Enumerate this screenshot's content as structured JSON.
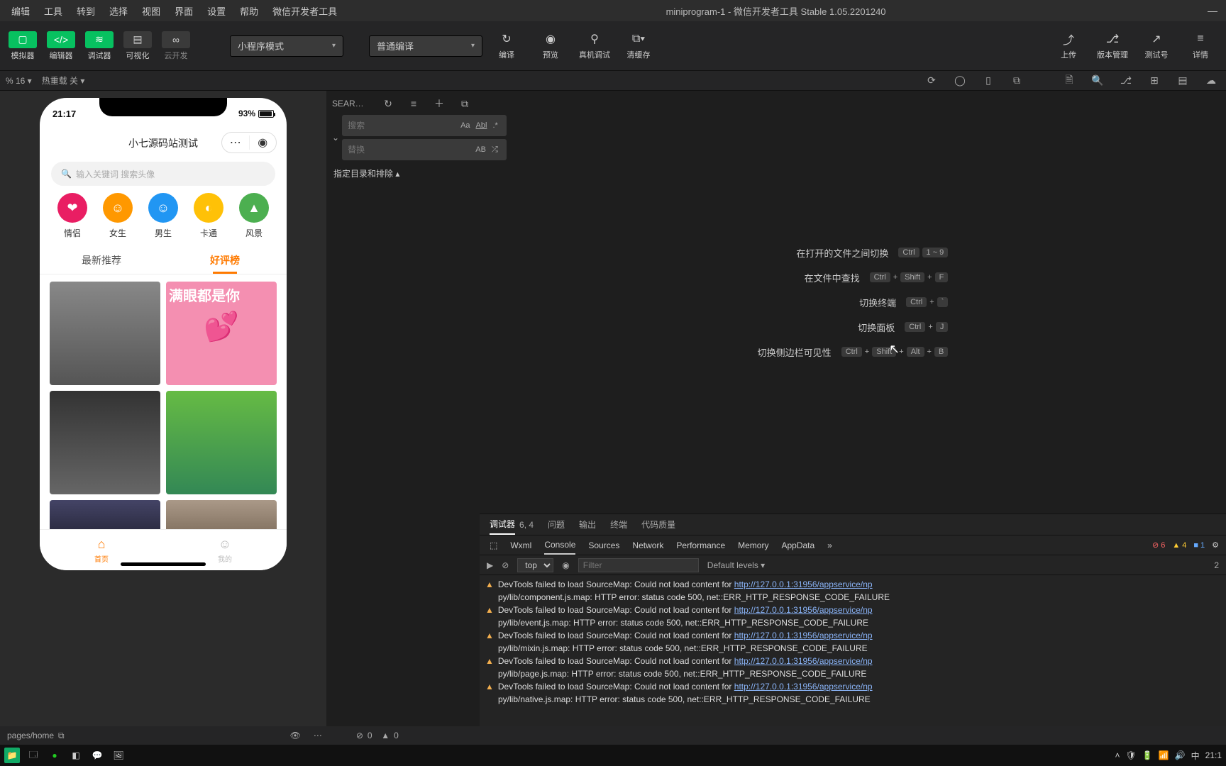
{
  "menu": [
    "编辑",
    "工具",
    "转到",
    "选择",
    "视图",
    "界面",
    "设置",
    "帮助",
    "微信开发者工具"
  ],
  "title": "miniprogram-1 - 微信开发者工具 Stable 1.05.2201240",
  "toolbar": {
    "views": [
      {
        "label": "模拟器"
      },
      {
        "label": "编辑器"
      },
      {
        "label": "调试器"
      },
      {
        "label": "可视化"
      },
      {
        "label": "云开发"
      }
    ],
    "mode": "小程序模式",
    "compile": "普通编译",
    "actions": [
      "编译",
      "预览",
      "真机调试",
      "清缓存"
    ],
    "right": [
      "上传",
      "版本管理",
      "测试号",
      "详情"
    ]
  },
  "status": {
    "zoom": "% 16 ▾",
    "hot": "热重载 关 ▾"
  },
  "phone": {
    "time": "21:17",
    "battery": "93%",
    "title": "小七源码站测试",
    "search": "输入关键词 搜索头像",
    "cats": [
      {
        "l": "情侣",
        "c": "#e91e63"
      },
      {
        "l": "女生",
        "c": "#ff9800"
      },
      {
        "l": "男生",
        "c": "#2196f3"
      },
      {
        "l": "卡通",
        "c": "#ffc107"
      },
      {
        "l": "风景",
        "c": "#4caf50"
      }
    ],
    "tabs": [
      "最新推荐",
      "好评榜"
    ],
    "tabActive": 1,
    "tiles": [
      "",
      "满眼都是你",
      "",
      "",
      "",
      ""
    ],
    "nav": [
      {
        "l": "首页",
        "a": true
      },
      {
        "l": "我的",
        "a": false
      }
    ]
  },
  "search": {
    "header": "SEAR…",
    "s": "搜索",
    "r": "替换",
    "dir": "指定目录和排除 ▴"
  },
  "shortcuts": [
    {
      "l": "在打开的文件之间切换",
      "k": [
        "Ctrl",
        "1 ~ 9"
      ]
    },
    {
      "l": "在文件中查找",
      "k": [
        "Ctrl",
        "+",
        "Shift",
        "+",
        "F"
      ]
    },
    {
      "l": "切换终端",
      "k": [
        "Ctrl",
        "+",
        "`"
      ]
    },
    {
      "l": "切换面板",
      "k": [
        "Ctrl",
        "+",
        "J"
      ]
    },
    {
      "l": "切换侧边栏可见性",
      "k": [
        "Ctrl",
        "+",
        "Shift",
        "+",
        "Alt",
        "+",
        "B"
      ]
    }
  ],
  "devtools": {
    "tabs1": [
      "调试器",
      "问题",
      "输出",
      "终端",
      "代码质量"
    ],
    "t1count": "6, 4",
    "tabs2": [
      "Wxml",
      "Console",
      "Sources",
      "Network",
      "Performance",
      "Memory",
      "AppData"
    ],
    "badges": {
      "err": "6",
      "warn": "4",
      "info": "1"
    },
    "ctx": "top",
    "filter": "Filter",
    "levels": "Default levels ▾",
    "hidden": "2",
    "logs": [
      {
        "u": "http://127.0.0.1:31956/appservice/np",
        "p": "py/lib/component.js.map"
      },
      {
        "u": "http://127.0.0.1:31956/appservice/np",
        "p": "py/lib/event.js.map"
      },
      {
        "u": "http://127.0.0.1:31956/appservice/np",
        "p": "py/lib/mixin.js.map"
      },
      {
        "u": "http://127.0.0.1:31956/appservice/np",
        "p": "py/lib/page.js.map"
      },
      {
        "u": "http://127.0.0.1:31956/appservice/np",
        "p": "py/lib/native.js.map"
      }
    ],
    "msg1": "DevTools failed to load SourceMap: Could not load content for ",
    "msg2": ": HTTP error: status code 500, net::ERR_HTTP_RESPONSE_CODE_FAILURE"
  },
  "bottom": {
    "path": "pages/home",
    "err": "0",
    "warn": "0"
  },
  "tray": {
    "time": "21:1",
    "ime": "中"
  }
}
